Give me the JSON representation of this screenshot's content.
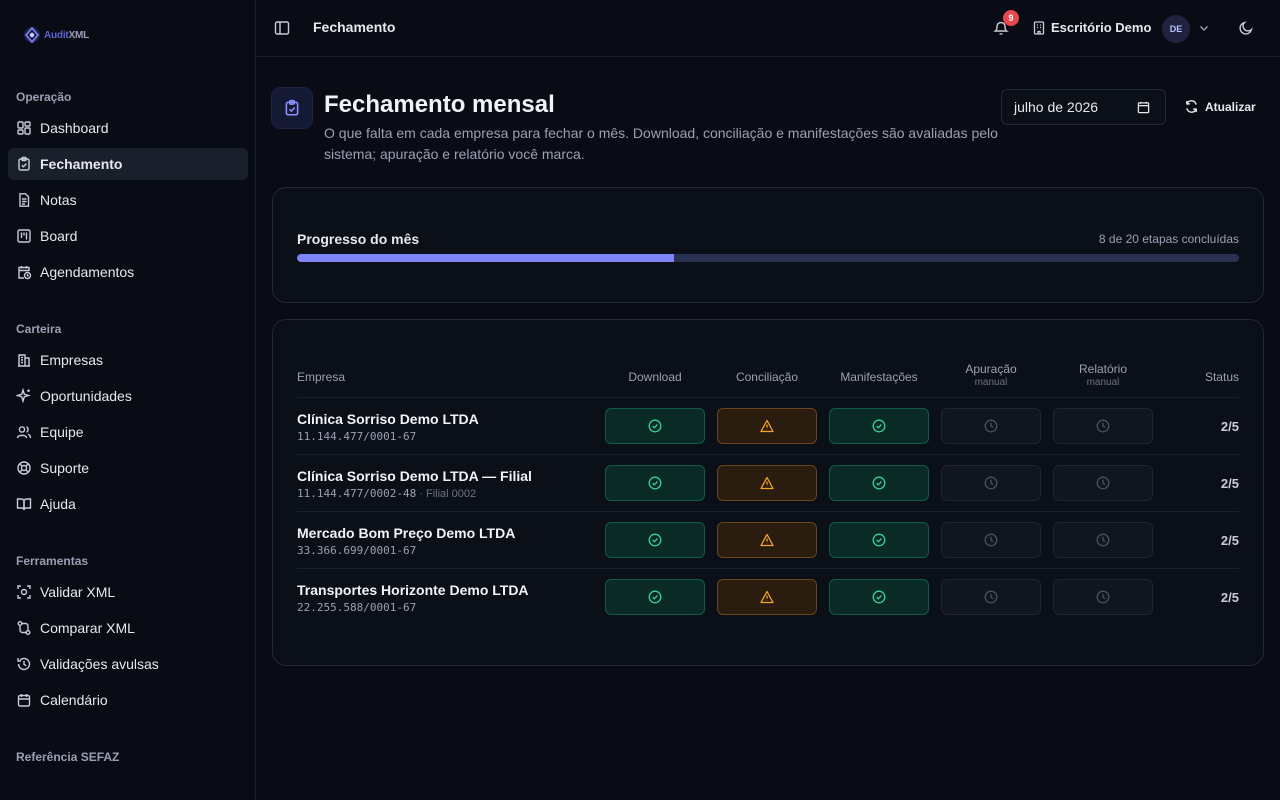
{
  "app": {
    "logo_a": "Audit",
    "logo_b": "XML"
  },
  "sidebar": {
    "sections": [
      {
        "title": "Operação",
        "items": [
          {
            "label": "Dashboard",
            "icon": "dashboard-icon"
          },
          {
            "label": "Fechamento",
            "icon": "clipboard-check-icon",
            "active": true
          },
          {
            "label": "Notas",
            "icon": "file-text-icon"
          },
          {
            "label": "Board",
            "icon": "kanban-icon"
          },
          {
            "label": "Agendamentos",
            "icon": "calendar-clock-icon"
          }
        ]
      },
      {
        "title": "Carteira",
        "items": [
          {
            "label": "Empresas",
            "icon": "building-icon"
          },
          {
            "label": "Oportunidades",
            "icon": "sparkles-icon"
          },
          {
            "label": "Equipe",
            "icon": "users-icon"
          },
          {
            "label": "Suporte",
            "icon": "lifebuoy-icon"
          },
          {
            "label": "Ajuda",
            "icon": "book-open-icon"
          }
        ]
      },
      {
        "title": "Ferramentas",
        "items": [
          {
            "label": "Validar XML",
            "icon": "scan-icon"
          },
          {
            "label": "Comparar XML",
            "icon": "git-compare-icon"
          },
          {
            "label": "Validações avulsas",
            "icon": "history-icon"
          },
          {
            "label": "Calendário",
            "icon": "calendar-icon"
          }
        ]
      },
      {
        "title": "Referência SEFAZ",
        "items": []
      }
    ]
  },
  "topbar": {
    "title": "Fechamento",
    "notifications": "9",
    "office": "Escritório Demo",
    "avatar": "DE"
  },
  "header": {
    "title": "Fechamento mensal",
    "description": "O que falta em cada empresa para fechar o mês. Download, conciliação e manifestações são avaliadas pelo sistema; apuração e relatório você marca.",
    "month": "julho de 2026",
    "refresh_label": "Atualizar"
  },
  "progress": {
    "label": "Progresso do mês",
    "count_text": "8 de 20 etapas concluídas",
    "done": 8,
    "total": 20,
    "color": "#7c84f4"
  },
  "table": {
    "columns": {
      "company": "Empresa",
      "download": "Download",
      "conciliacao": "Conciliação",
      "manifestacoes": "Manifestações",
      "apuracao": "Apuração",
      "relatorio": "Relatório",
      "manual_sub": "manual",
      "status": "Status"
    },
    "rows": [
      {
        "name": "Clínica Sorriso Demo LTDA",
        "cnpj": "11.144.477/0001-67",
        "extra": "",
        "steps": [
          "ok",
          "warn",
          "ok",
          "pending",
          "pending"
        ],
        "status": "2/5"
      },
      {
        "name": "Clínica Sorriso Demo LTDA — Filial",
        "cnpj": "11.144.477/0002-48",
        "extra": " · Filial 0002",
        "steps": [
          "ok",
          "warn",
          "ok",
          "pending",
          "pending"
        ],
        "status": "2/5"
      },
      {
        "name": "Mercado Bom Preço Demo LTDA",
        "cnpj": "33.366.699/0001-67",
        "extra": "",
        "steps": [
          "ok",
          "warn",
          "ok",
          "pending",
          "pending"
        ],
        "status": "2/5"
      },
      {
        "name": "Transportes Horizonte Demo LTDA",
        "cnpj": "22.255.588/0001-67",
        "extra": "",
        "steps": [
          "ok",
          "warn",
          "ok",
          "pending",
          "pending"
        ],
        "status": "2/5"
      }
    ]
  }
}
